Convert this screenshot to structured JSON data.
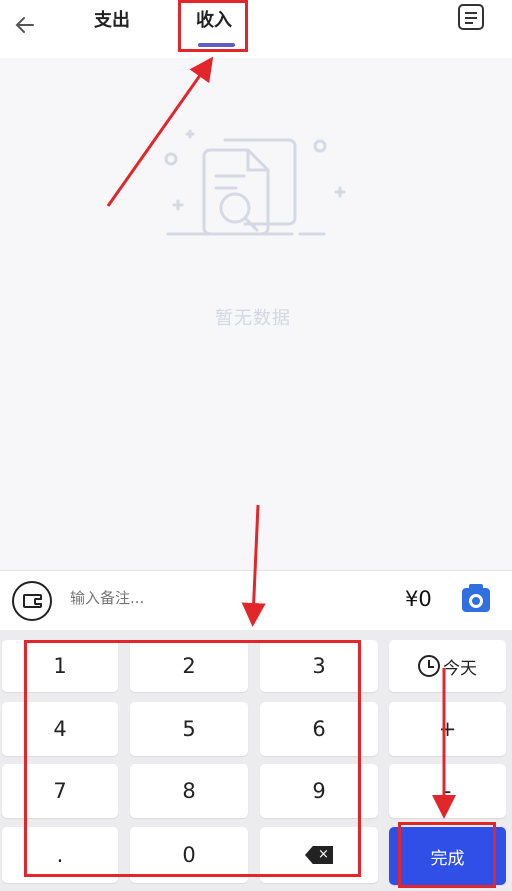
{
  "header": {
    "back_icon": "back-arrow-icon",
    "tabs": [
      {
        "label": "支出",
        "active": false
      },
      {
        "label": "收入",
        "active": true
      }
    ],
    "right_icon": "document-icon"
  },
  "empty_state": {
    "text": "暂无数据",
    "icon": "document-search-icon"
  },
  "note_row": {
    "wallet_icon": "wallet-icon",
    "placeholder": "输入备注...",
    "amount": "¥0",
    "camera_icon": "camera-icon"
  },
  "keypad": {
    "keys": [
      "1",
      "2",
      "3",
      "4",
      "5",
      "6",
      "7",
      "8",
      "9",
      ".",
      "0"
    ],
    "backspace_icon": "backspace-icon",
    "today_label": "今天",
    "clock_icon": "clock-icon",
    "plus_label": "+",
    "minus_label": "-",
    "done_label": "完成"
  },
  "colors": {
    "accent": "#5b5fc7",
    "done_button": "#2f4fe6",
    "annotation": "#e3262b"
  }
}
